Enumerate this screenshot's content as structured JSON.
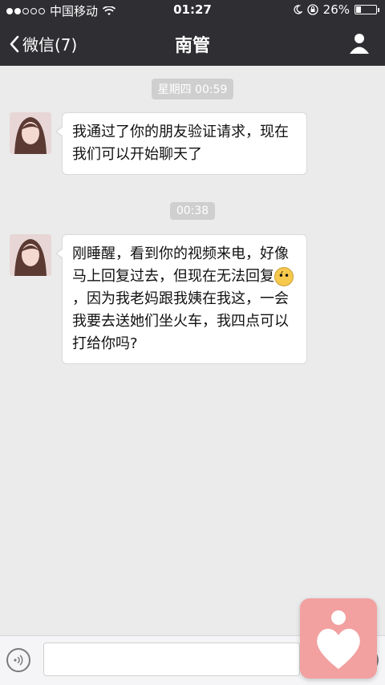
{
  "status_bar": {
    "carrier": "中国移动",
    "time": "01:27",
    "battery_percent_text": "26%",
    "battery_level": 0.26
  },
  "nav": {
    "back_label": "微信(7)",
    "title": "南管"
  },
  "chat": {
    "timestamps": [
      "星期四 00:59",
      "00:38"
    ],
    "messages": [
      {
        "text": "我通过了你的朋友验证请求，现在我们可以开始聊天了"
      },
      {
        "text_before_emoji": "刚睡醒，看到你的视频来电，好像马上回复过去，但现在无法回复",
        "emoji_icon": "flushed-face-emoji",
        "text_after_emoji": "，因为我老妈跟我姨在我这，一会我要去送她们坐火车，我四点可以打给你吗?"
      }
    ]
  },
  "input_bar": {
    "voice_icon": "voice-icon",
    "text_value": "",
    "placeholder": ""
  },
  "overlay": {
    "icon": "heart-app-icon",
    "color": "#f2a0a0"
  },
  "colors": {
    "header_bg": "#2e2e33",
    "chat_bg": "#ebebeb",
    "bubble_bg": "#ffffff"
  }
}
